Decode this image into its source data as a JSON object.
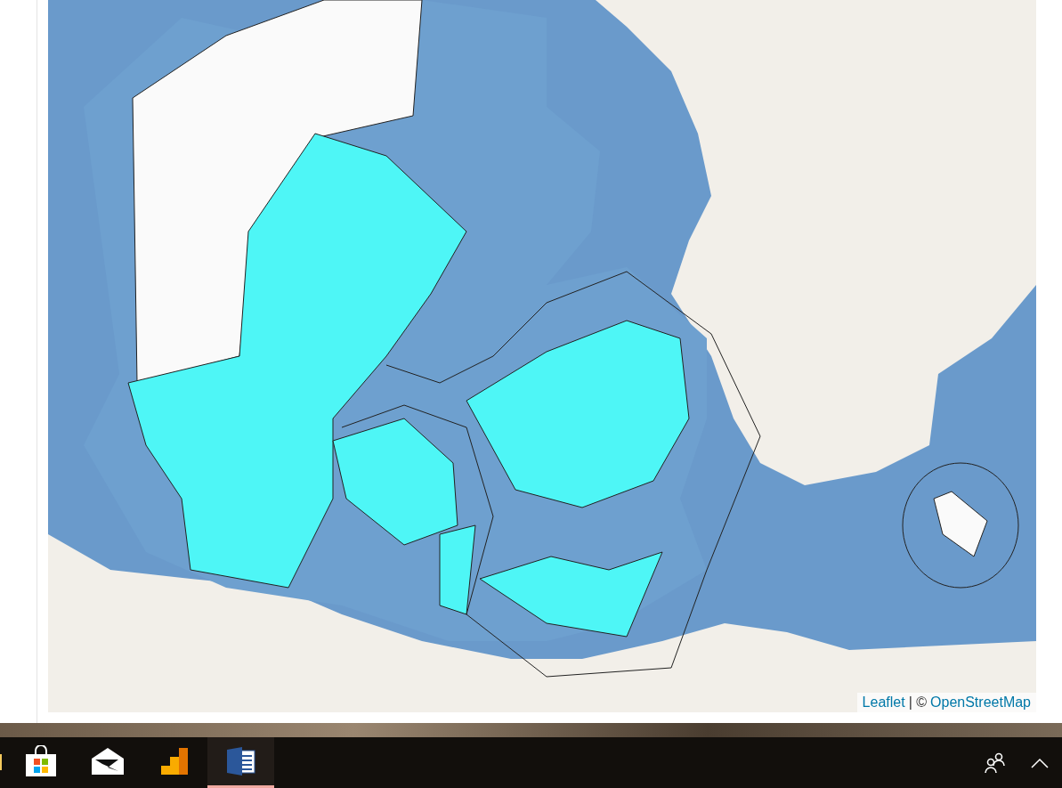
{
  "map": {
    "attribution": {
      "link_1": "Leaflet",
      "separator": "| ©",
      "link_2": "OpenStreetMap"
    }
  },
  "taskbar": {
    "apps": [
      {
        "kind": "folder",
        "selected": false
      },
      {
        "kind": "store",
        "selected": false
      },
      {
        "kind": "mail",
        "selected": false
      },
      {
        "kind": "analytics",
        "selected": false
      },
      {
        "kind": "word",
        "selected": true
      }
    ],
    "tray": [
      {
        "kind": "people"
      },
      {
        "kind": "chevron"
      }
    ]
  }
}
